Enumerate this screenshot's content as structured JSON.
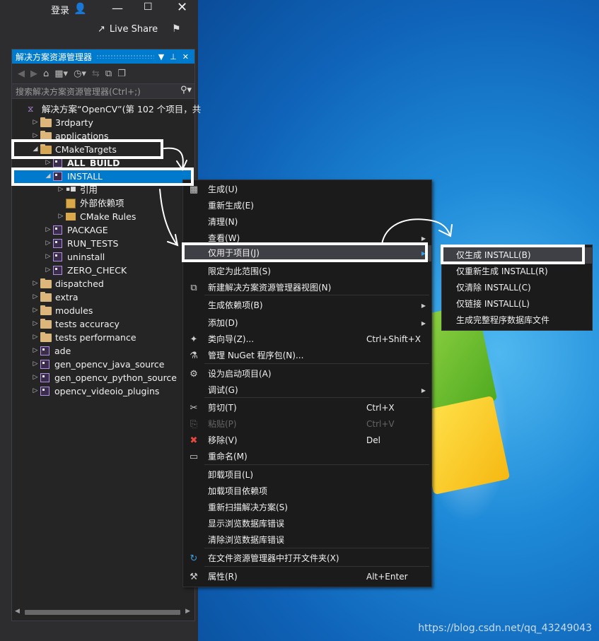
{
  "titlebar": {
    "login": "登录",
    "liveshare": "Live Share"
  },
  "solution_explorer": {
    "title": "解决方案资源管理器",
    "search_placeholder": "搜索解决方案资源管理器(Ctrl+;)",
    "tree": [
      {
        "label": "解决方案“OpenCV”(第 102 个项目，共",
        "kind": "solution",
        "depth": 0
      },
      {
        "label": "3rdparty",
        "kind": "folder",
        "depth": 1
      },
      {
        "label": "applications",
        "kind": "folder",
        "depth": 1
      },
      {
        "label": "CMakeTargets",
        "kind": "folder-open",
        "depth": 1
      },
      {
        "label": "ALL_BUILD",
        "kind": "project-bold",
        "depth": 2
      },
      {
        "label": "INSTALL",
        "kind": "project",
        "depth": 2,
        "selected": true
      },
      {
        "label": "引用",
        "kind": "references",
        "depth": 3
      },
      {
        "label": "外部依赖项",
        "kind": "external",
        "depth": 3
      },
      {
        "label": "CMake Rules",
        "kind": "rules",
        "depth": 3
      },
      {
        "label": "PACKAGE",
        "kind": "project",
        "depth": 2
      },
      {
        "label": "RUN_TESTS",
        "kind": "project",
        "depth": 2
      },
      {
        "label": "uninstall",
        "kind": "project",
        "depth": 2
      },
      {
        "label": "ZERO_CHECK",
        "kind": "project",
        "depth": 2
      },
      {
        "label": "dispatched",
        "kind": "folder",
        "depth": 1
      },
      {
        "label": "extra",
        "kind": "folder",
        "depth": 1
      },
      {
        "label": "modules",
        "kind": "folder",
        "depth": 1
      },
      {
        "label": "tests accuracy",
        "kind": "folder",
        "depth": 1
      },
      {
        "label": "tests performance",
        "kind": "folder",
        "depth": 1
      },
      {
        "label": "ade",
        "kind": "project",
        "depth": 1
      },
      {
        "label": "gen_opencv_java_source",
        "kind": "project",
        "depth": 1
      },
      {
        "label": "gen_opencv_python_source",
        "kind": "project",
        "depth": 1
      },
      {
        "label": "opencv_videoio_plugins",
        "kind": "project",
        "depth": 1
      }
    ]
  },
  "context_menu": {
    "items": [
      {
        "label": "生成(U)",
        "icon": "build-icon"
      },
      {
        "label": "重新生成(E)"
      },
      {
        "label": "清理(N)"
      },
      {
        "label": "查看(W)",
        "submenu": true
      },
      {
        "label": "仅用于项目(J)",
        "submenu": true,
        "highlighted": true
      },
      {
        "label": "限定为此范围(S)"
      },
      {
        "label": "新建解决方案资源管理器视图(N)",
        "icon": "new-view-icon"
      },
      {
        "label": "生成依赖项(B)",
        "submenu": true
      },
      {
        "label": "添加(D)",
        "submenu": true
      },
      {
        "label": "类向导(Z)...",
        "shortcut": "Ctrl+Shift+X",
        "icon": "class-wizard-icon"
      },
      {
        "label": "管理 NuGet 程序包(N)...",
        "icon": "nuget-icon"
      },
      {
        "label": "设为启动项目(A)",
        "icon": "gear-icon"
      },
      {
        "label": "调试(G)",
        "submenu": true
      },
      {
        "label": "剪切(T)",
        "shortcut": "Ctrl+X",
        "icon": "scissors-icon"
      },
      {
        "label": "粘贴(P)",
        "shortcut": "Ctrl+V",
        "icon": "paste-icon",
        "disabled": true
      },
      {
        "label": "移除(V)",
        "shortcut": "Del",
        "icon": "remove-icon"
      },
      {
        "label": "重命名(M)",
        "icon": "rename-icon"
      },
      {
        "label": "卸载项目(L)"
      },
      {
        "label": "加载项目依赖项"
      },
      {
        "label": "重新扫描解决方案(S)"
      },
      {
        "label": "显示浏览数据库错误"
      },
      {
        "label": "清除浏览数据库错误"
      },
      {
        "label": "在文件资源管理器中打开文件夹(X)",
        "icon": "open-folder-icon"
      },
      {
        "label": "属性(R)",
        "shortcut": "Alt+Enter",
        "icon": "wrench-icon"
      }
    ]
  },
  "submenu": {
    "items": [
      {
        "label": "仅生成 INSTALL(B)",
        "highlighted": true
      },
      {
        "label": "仅重新生成 INSTALL(R)"
      },
      {
        "label": "仅清除 INSTALL(C)"
      },
      {
        "label": "仅链接 INSTALL(L)"
      },
      {
        "label": "生成完整程序数据库文件"
      }
    ]
  },
  "watermark": "https://blog.csdn.net/qq_43249043",
  "colors": {
    "vs_bg": "#2d2d30",
    "accent": "#007acc",
    "menu_bg": "#1b1b1c",
    "menu_highlight": "#3f3f46"
  }
}
